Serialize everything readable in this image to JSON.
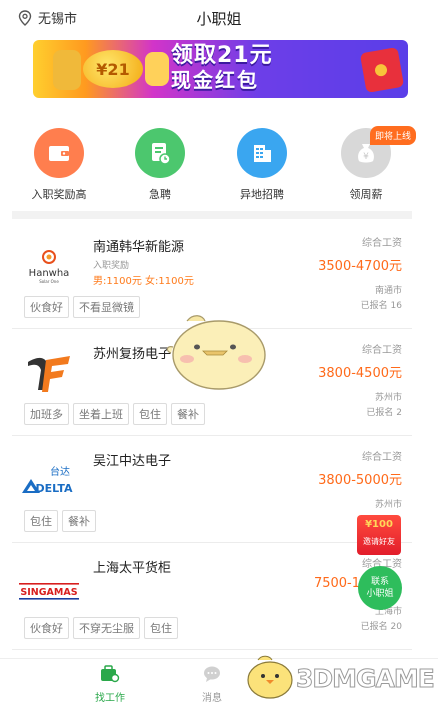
{
  "header": {
    "location": "无锡市",
    "title": "小职姐"
  },
  "banner": {
    "line1": "领取21元",
    "line2": "现金红包",
    "coin_text": "¥21"
  },
  "quick_actions": [
    {
      "label": "入职奖励高",
      "color": "#ff7e4e",
      "icon": "wallet-icon"
    },
    {
      "label": "急聘",
      "color": "#4cc76e",
      "icon": "document-clock-icon"
    },
    {
      "label": "异地招聘",
      "color": "#3aa6f0",
      "icon": "building-icon"
    },
    {
      "label": "领周薪",
      "color": "#d8d8d8",
      "icon": "money-bag-icon"
    }
  ],
  "quick_badge": "即将上线",
  "jobs": [
    {
      "name": "南通韩华新能源",
      "logo_text": "Hanwha",
      "logo_sub": "Solar One",
      "sub": "入职奖励",
      "bonus": "男:1100元 女:1100元",
      "pay_label": "综合工资",
      "salary": "3500-4700元",
      "city": "南通市",
      "signed": "已报名 16",
      "tags": [
        "伙食好",
        "不看显微镜"
      ]
    },
    {
      "name": "苏州复扬电子",
      "logo_text": "F",
      "pay_label": "综合工资",
      "salary": "3800-4500元",
      "city": "苏州市",
      "signed": "已报名 2",
      "tags": [
        "加班多",
        "坐着上班",
        "包住",
        "餐补"
      ]
    },
    {
      "name": "吴江中达电子",
      "logo_text": "DELTA",
      "logo_cn": "台达",
      "pay_label": "综合工资",
      "salary": "3800-5000元",
      "city": "苏州市",
      "tags": [
        "包住",
        "餐补"
      ]
    },
    {
      "name": "上海太平货柜",
      "logo_text": "SINGAMAS",
      "pay_label": "综合工资",
      "salary": "7500-1",
      "city": "上海市",
      "signed": "已报名 20",
      "tags": [
        "伙食好",
        "不穿无尘服",
        "包住"
      ]
    }
  ],
  "float": {
    "invite_amount": "¥100",
    "invite_label": "邀请好友",
    "contact_line1": "联系",
    "contact_line2": "小职姐"
  },
  "tabs": [
    {
      "label": "找工作",
      "active": true
    },
    {
      "label": "消息",
      "active": false
    }
  ],
  "watermark": "3DMGAME",
  "colors": {
    "accent_green": "#2aa84a",
    "salary_orange": "#ff6a1a"
  }
}
